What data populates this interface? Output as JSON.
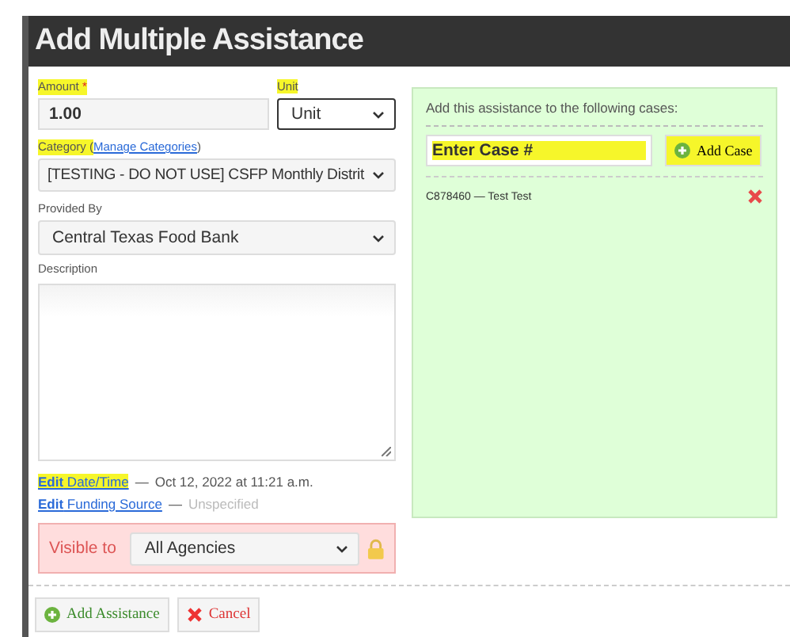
{
  "dialog": {
    "title": "Add Multiple Assistance"
  },
  "amount": {
    "label": "Amount",
    "required_mark": "*",
    "highlighted": true,
    "value": "1.00"
  },
  "unit": {
    "label": "Unit",
    "highlighted": true,
    "value": "Unit"
  },
  "category": {
    "label": "Category (",
    "highlighted": true,
    "link": "Manage Categories",
    "close": ")",
    "value": "[TESTING - DO NOT USE] CSFP Monthly Distrit"
  },
  "provided_by": {
    "label": "Provided By",
    "highlighted": false,
    "value": "Central Texas Food Bank"
  },
  "description": {
    "label": "Description"
  },
  "date": {
    "link": "**Edit** Date/Time",
    "highlighted": true,
    "separator": "—",
    "value": "Oct 12, 2022 at 11:21 a.m."
  },
  "funding": {
    "link": "**Edit** Funding Source",
    "highlighted": false,
    "separator": "—",
    "value": "Unspecified"
  },
  "visibility": {
    "label": "Visible to",
    "value": "All Agencies",
    "locked": true
  },
  "cases_panel": {
    "heading": "Add this assistance to the following cases:",
    "case_input": {
      "placeholder": "Enter Case #",
      "highlighted": true
    },
    "add_button": {
      "label": "Add Case",
      "highlighted": true
    },
    "cases": [
      {
        "text": "C878460 — Test Test"
      }
    ]
  },
  "buttons": [
    {
      "kind": "add",
      "label": "Add Assistance"
    },
    {
      "kind": "cancel",
      "label": "Cancel"
    }
  ]
}
